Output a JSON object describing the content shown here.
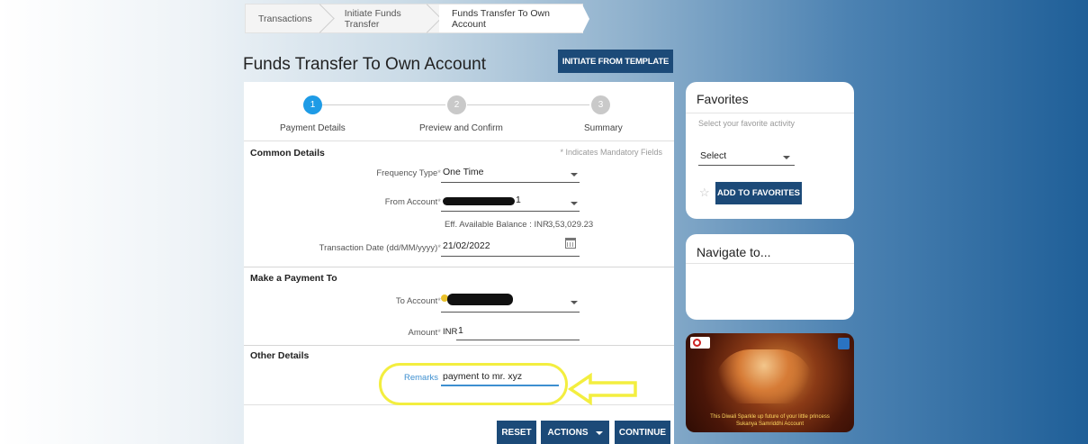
{
  "breadcrumb": [
    "Transactions",
    "Initiate Funds Transfer",
    "Funds Transfer To Own Account"
  ],
  "page_title": "Funds Transfer To Own Account",
  "initiate_template_label": "INITIATE FROM TEMPLATE",
  "steps": [
    {
      "number": "1",
      "label": "Payment Details",
      "state": "active"
    },
    {
      "number": "2",
      "label": "Preview and Confirm",
      "state": "pending"
    },
    {
      "number": "3",
      "label": "Summary",
      "state": "pending"
    }
  ],
  "common_details": {
    "title": "Common Details",
    "mandatory_note": "* Indicates Mandatory Fields",
    "frequency_label": "Frequency Type",
    "frequency_value": "One Time",
    "from_account_label": "From Account",
    "from_account_value": "1",
    "balance_text": "Eff. Available Balance : INR",
    "balance_value": "3,53,029.23",
    "date_label": "Transaction Date (dd/MM/yyyy)",
    "date_value": "21/02/2022"
  },
  "payment_to": {
    "title": "Make a Payment To",
    "to_account_label": "To Account",
    "amount_label": "Amount",
    "currency": "INR",
    "amount_value": "1"
  },
  "other_details": {
    "title": "Other Details",
    "remarks_label": "Remarks",
    "remarks_value": "payment to mr. xyz"
  },
  "actions": {
    "reset": "RESET",
    "actions": "ACTIONS",
    "continue": "CONTINUE"
  },
  "favorites": {
    "title": "Favorites",
    "hint": "Select your favorite activity",
    "select_value": "Select",
    "add_button": "ADD TO FAVORITES"
  },
  "navigate": {
    "title": "Navigate to..."
  },
  "promo": {
    "line1": "This Diwali Sparkle up future of your little princess",
    "line2": "Sukanya Samriddhi Account"
  },
  "colors": {
    "primary_button": "#1c4a78",
    "step_active": "#1e9be6",
    "step_pending": "#c9c9c9",
    "highlight_yellow": "#f3ee3f",
    "link_blue": "#3d8fd0"
  }
}
